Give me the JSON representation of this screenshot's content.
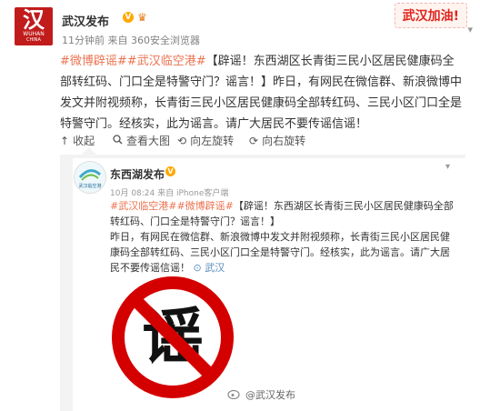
{
  "post": {
    "avatar_glyph": "汉",
    "avatar_sub": "WUHAN",
    "avatar_sub2": "CHINA",
    "author": "武汉发布",
    "meta": "11分钟前 来自 360安全浏览器",
    "banner": "武汉加油!",
    "tags": [
      "#微博辟谣#",
      "#武汉临空港#"
    ],
    "body": "【辟谣！东西湖区长青街三民小区居民健康码全部转红码、门口全是特警守门？谣言！】昨日，有网民在微信群、新浪微博中发文并附视频称，长青街三民小区居民健康码全部转红码、三民小区门口全是特警守门。经核实，此为谣言。请广大居民不要传谣信谣！"
  },
  "actions": {
    "collect": "收起",
    "view_large": "查看大图",
    "rotate_left": "向左旋转",
    "rotate_right": "向右旋转"
  },
  "repost": {
    "avatar_text": "武汉临空港",
    "author": "东西湖发布",
    "meta": "10月 08:24 来自 iPhone客户端",
    "tags": [
      "#武汉临空港#",
      "#微博辟谣#"
    ],
    "headline": "【辟谣！东西湖区长青街三民小区居民健康码全部转红码、门口全是特警守门？谣言！】",
    "body": "昨日，有网民在微信群、新浪微博中发文并附视频称，长青街三民小区居民健康码全部转红码、三民小区门口全是特警守门。经核实，此为谣言。请广大居民不要传谣信谣！",
    "location": "武汉",
    "image_text": "谣",
    "watermark": "@武汉发布"
  },
  "colors": {
    "tag": "#eb7350",
    "brand_red": "#c11c1c",
    "badge": "#ffa800",
    "prohibit": "#d40000"
  }
}
